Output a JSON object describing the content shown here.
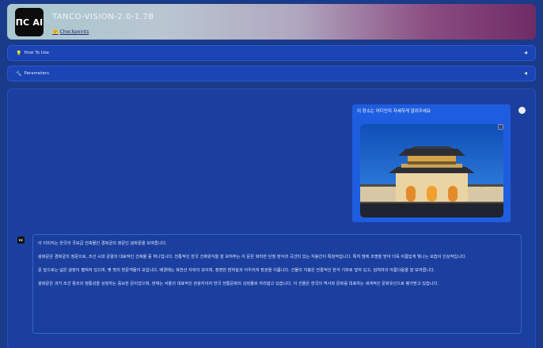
{
  "header": {
    "logo_text": "ПC AI",
    "title": "TANCO-VISION-2.0-1.7B",
    "checkpoints_emoji": "🤗",
    "checkpoints_label": "Checkpoints"
  },
  "accordions": [
    {
      "icon": "💡",
      "label": "How To Use"
    },
    {
      "icon": "🔧",
      "label": "Parameters"
    }
  ],
  "chat": {
    "user_message": "이 장소는 어디인지 자세하게 알려주세요",
    "bot_paragraphs": [
      "이 이미지는 한국의 국보급 건축물인 경복궁의 정문인 광화문을 보여줍니다.",
      "광화문은 경복궁의 정문으로, 조선 시대 궁궐의 대표적인 건축물 중 하나입니다. 전통적인 한국 건축양식을 잘 보여주는 이 문은 화려한 단청 장식과 곡선미 있는 지붕선이 특징적입니다. 특히 밤에 조명을 받아 더욱 아름답게 빛나는 모습이 인상적입니다.",
      "문 앞으로는 넓은 광장이 펼쳐져 있으며, 몇 명의 방문객들이 보입니다. 배경에는 북한산 자락이 보이며, 청명한 밤하늘과 어우러져 장관을 이룹니다. 건물의 지붕은 전통적인 한식 기와로 덮여 있고, 검처마의 아름다움을 잘 보여줍니다.",
      "광화문은 과거 조선 왕조의 정통성을 상징하는 중요한 문이었으며, 현재는 서울의 대표적인 관광지이자 한국 전통문화의 상징물로 자리잡고 있습니다. 이 건물은 한국의 역사와 문화를 대표하는 세계적인 문화유산으로 평가받고 있습니다."
    ]
  },
  "colors": {
    "background": "#1a3a8a",
    "accordion": "#1b45b4",
    "user_bubble": "#1f5de0"
  }
}
